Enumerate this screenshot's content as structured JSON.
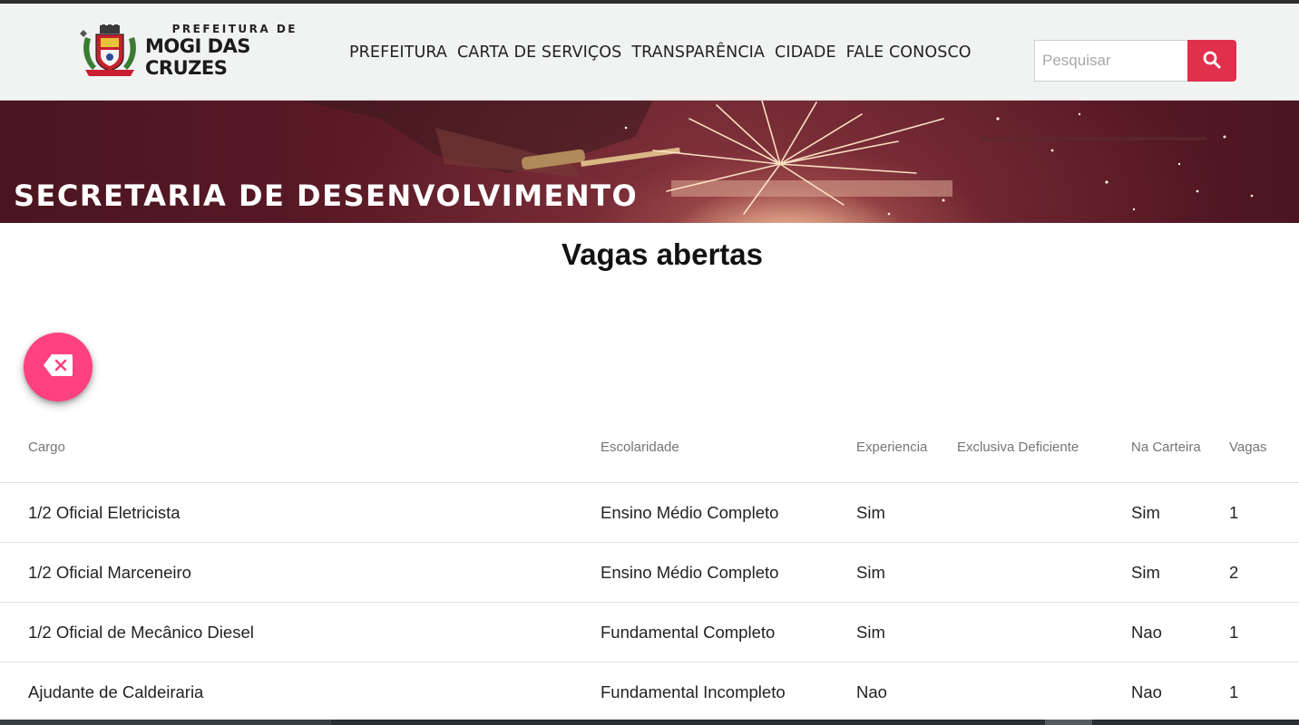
{
  "header": {
    "logo_line1": "PREFEITURA DE",
    "logo_line2": "MOGI DAS CRUZES",
    "nav": [
      {
        "label": "PREFEITURA"
      },
      {
        "label": "CARTA DE SERVIÇOS"
      },
      {
        "label": "TRANSPARÊNCIA"
      },
      {
        "label": "CIDADE"
      },
      {
        "label": "FALE CONOSCO"
      }
    ],
    "search": {
      "placeholder": "Pesquisar",
      "value": ""
    }
  },
  "banner": {
    "title": "SECRETARIA DE DESENVOLVIMENTO"
  },
  "main": {
    "title": "Vagas abertas"
  },
  "table": {
    "headers": {
      "cargo": "Cargo",
      "escolaridade": "Escolaridade",
      "experiencia": "Experiencia",
      "deficiente": "Exclusiva Deficiente",
      "carteira": "Na Carteira",
      "vagas": "Vagas"
    },
    "rows": [
      {
        "cargo": "1/2 Oficial Eletricista",
        "escolaridade": "Ensino Médio Completo",
        "experiencia": "Sim",
        "deficiente": "",
        "carteira": "Sim",
        "vagas": "1"
      },
      {
        "cargo": "1/2 Oficial Marceneiro",
        "escolaridade": "Ensino Médio Completo",
        "experiencia": "Sim",
        "deficiente": "",
        "carteira": "Sim",
        "vagas": "2"
      },
      {
        "cargo": "1/2 Oficial de Mecânico Diesel",
        "escolaridade": "Fundamental Completo",
        "experiencia": "Sim",
        "deficiente": "",
        "carteira": "Nao",
        "vagas": "1"
      },
      {
        "cargo": "Ajudante de Caldeiraria",
        "escolaridade": "Fundamental Incompleto",
        "experiencia": "Nao",
        "deficiente": "",
        "carteira": "Nao",
        "vagas": "1"
      }
    ]
  },
  "colors": {
    "accent": "#e0304d",
    "fab": "#ff4081",
    "header_bg": "#f1f2f2",
    "banner_bg": "#5b1a26"
  },
  "icons": {
    "search": "search-icon",
    "fab": "backspace-icon",
    "crest": "city-crest-icon"
  }
}
